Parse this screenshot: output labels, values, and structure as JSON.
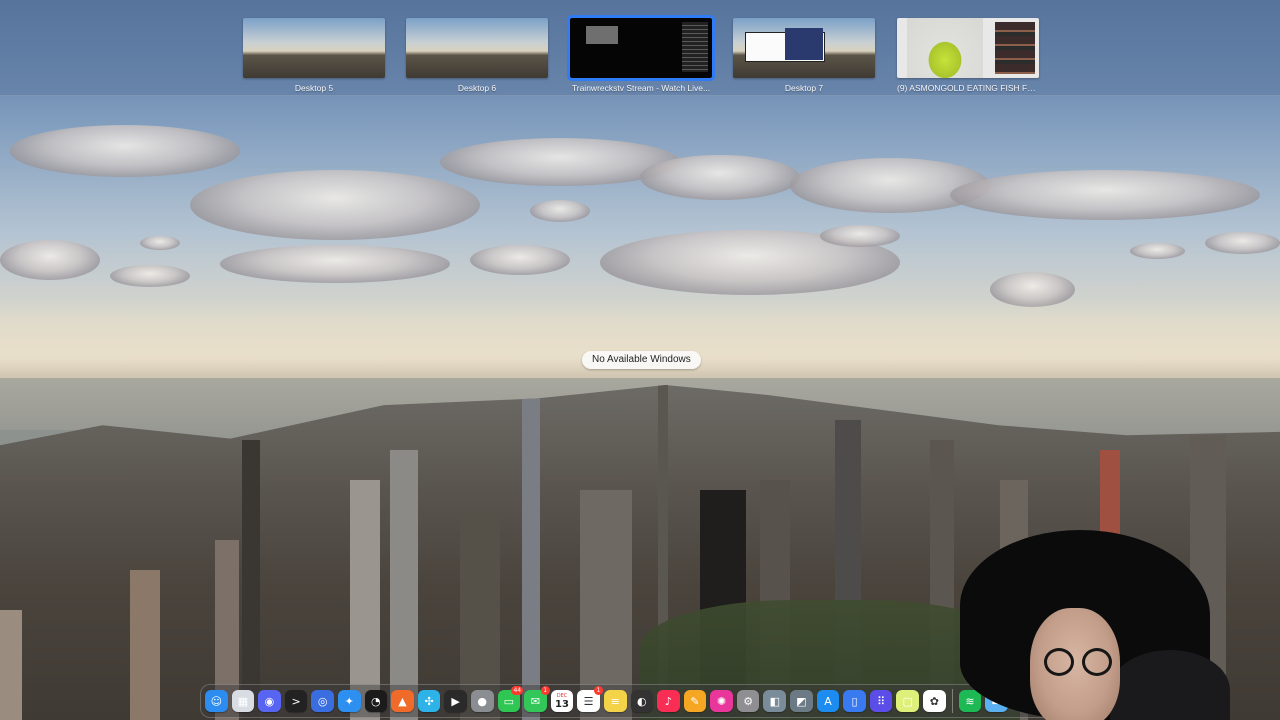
{
  "spaces": [
    {
      "label": "Desktop 5",
      "kind": "desktop",
      "active": false
    },
    {
      "label": "Desktop 6",
      "kind": "desktop",
      "active": false
    },
    {
      "label": "Trainwreckstv Stream - Watch Live...",
      "kind": "stream",
      "active": true
    },
    {
      "label": "Desktop 7",
      "kind": "window",
      "active": false
    },
    {
      "label": "(9) ASMONGOLD EATING FISH FOR...",
      "kind": "video",
      "active": false
    }
  ],
  "center_message": "No Available Windows",
  "dock": {
    "items": [
      {
        "name": "finder-icon",
        "glyph": "☺",
        "color": "#2c8cf0"
      },
      {
        "name": "launchpad-grid-icon",
        "glyph": "▦",
        "color": "#d9dce2"
      },
      {
        "name": "discord-icon",
        "glyph": "◉",
        "color": "#5865f2"
      },
      {
        "name": "terminal-icon",
        "glyph": ">",
        "color": "#222222"
      },
      {
        "name": "proxy-app-icon",
        "glyph": "◎",
        "color": "#3a6de0"
      },
      {
        "name": "safari-icon",
        "glyph": "✦",
        "color": "#2d8ff0"
      },
      {
        "name": "activity-monitor-icon",
        "glyph": "◔",
        "color": "#1b1b1b"
      },
      {
        "name": "vector-app-icon",
        "glyph": "▲",
        "color": "#f06a2a"
      },
      {
        "name": "xcode-tools-icon",
        "glyph": "✣",
        "color": "#2db3e8"
      },
      {
        "name": "final-cut-icon",
        "glyph": "▶",
        "color": "#2a2a2a"
      },
      {
        "name": "compressor-icon",
        "glyph": "●",
        "color": "#8a8d92"
      },
      {
        "name": "facetime-icon",
        "glyph": "▭",
        "color": "#2fc653",
        "badge": "44"
      },
      {
        "name": "messages-icon",
        "glyph": "✉",
        "color": "#33c759",
        "badge": "1"
      },
      {
        "name": "calendar-icon",
        "glyph": "13",
        "color": "#ffffff",
        "month": "DEC"
      },
      {
        "name": "reminders-icon",
        "glyph": "☰",
        "color": "#ffffff",
        "badge": "1"
      },
      {
        "name": "notes-icon",
        "glyph": "≡",
        "color": "#f5d349"
      },
      {
        "name": "logic-pro-icon",
        "glyph": "◐",
        "color": "#333333"
      },
      {
        "name": "music-icon",
        "glyph": "♪",
        "color": "#fa2d55"
      },
      {
        "name": "pages-icon",
        "glyph": "✎",
        "color": "#f5a623"
      },
      {
        "name": "photo-booth-icon",
        "glyph": "✺",
        "color": "#e8369a"
      },
      {
        "name": "system-settings-icon",
        "glyph": "⚙",
        "color": "#8e8e93"
      },
      {
        "name": "preview-icon",
        "glyph": "◧",
        "color": "#7a8b99"
      },
      {
        "name": "image-capture-icon",
        "glyph": "◩",
        "color": "#6c7a86"
      },
      {
        "name": "app-store-icon",
        "glyph": "A",
        "color": "#1c8cf0"
      },
      {
        "name": "keynote-icon",
        "glyph": "▯",
        "color": "#3a7af0"
      },
      {
        "name": "launchpad-apps-icon",
        "glyph": "⠿",
        "color": "#5b4ee8"
      },
      {
        "name": "stickies-icon",
        "glyph": "▢",
        "color": "#dff07a"
      },
      {
        "name": "chatgpt-icon",
        "glyph": "✿",
        "color": "#ffffff"
      },
      {
        "name": "spotify-icon",
        "glyph": "≋",
        "color": "#1db954"
      },
      {
        "name": "folder-icon",
        "glyph": "▬",
        "color": "#5ab0f0"
      }
    ]
  }
}
